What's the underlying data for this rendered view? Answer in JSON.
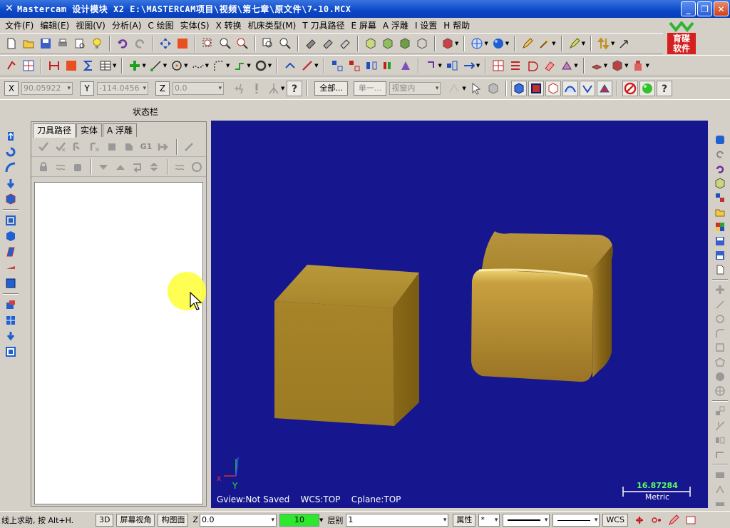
{
  "window": {
    "title": "Mastercam 设计模块  X2  E:\\MASTERCAM项目\\视频\\第七章\\原文件\\7-10.MCX",
    "controls": [
      "_",
      "❐",
      "✕"
    ]
  },
  "menu": [
    "文件(F)",
    "编辑(E)",
    "视图(V)",
    "分析(A)",
    "C 绘图",
    "实体(S)",
    "X 转换",
    "机床类型(M)",
    "T 刀具路径",
    "E 屏幕",
    "A 浮雕",
    "I 设置",
    "H 帮助"
  ],
  "brand": {
    "line1": "育碟",
    "line2": "软件"
  },
  "coords": {
    "x_label": "X",
    "x_value": "90.05922",
    "y_label": "Y",
    "y_value": "-114.0456",
    "z_label": "Z",
    "z_value": "0.0",
    "select_all": "全部...",
    "select_single": "单一...",
    "view_mode": "视窗内"
  },
  "status_label": "状态栏",
  "manager": {
    "tabs": [
      "刀具路径",
      "实体",
      "A 浮雕"
    ],
    "op_label": "G1"
  },
  "viewport": {
    "gview": "Gview:Not Saved",
    "wcs": "WCS:TOP",
    "cplane": "Cplane:TOP",
    "scale_value": "16.87284",
    "scale_unit": "Metric",
    "axis_y": "Y",
    "axis_x": "X",
    "background_color": "#16168f",
    "solid_color": "#b08a2a"
  },
  "bottom": {
    "hint": "线上求助, 按 Alt+H.",
    "btn_3d": "3D",
    "btn_screen_view": "屏幕视角",
    "btn_construct_plane": "构图面",
    "z_label": "Z",
    "z_value": "0.0",
    "level_value": "10",
    "layer_label": "层别",
    "layer_value": "1",
    "attr_btn": "属性",
    "point_style": "*",
    "wcs_btn": "WCS"
  }
}
